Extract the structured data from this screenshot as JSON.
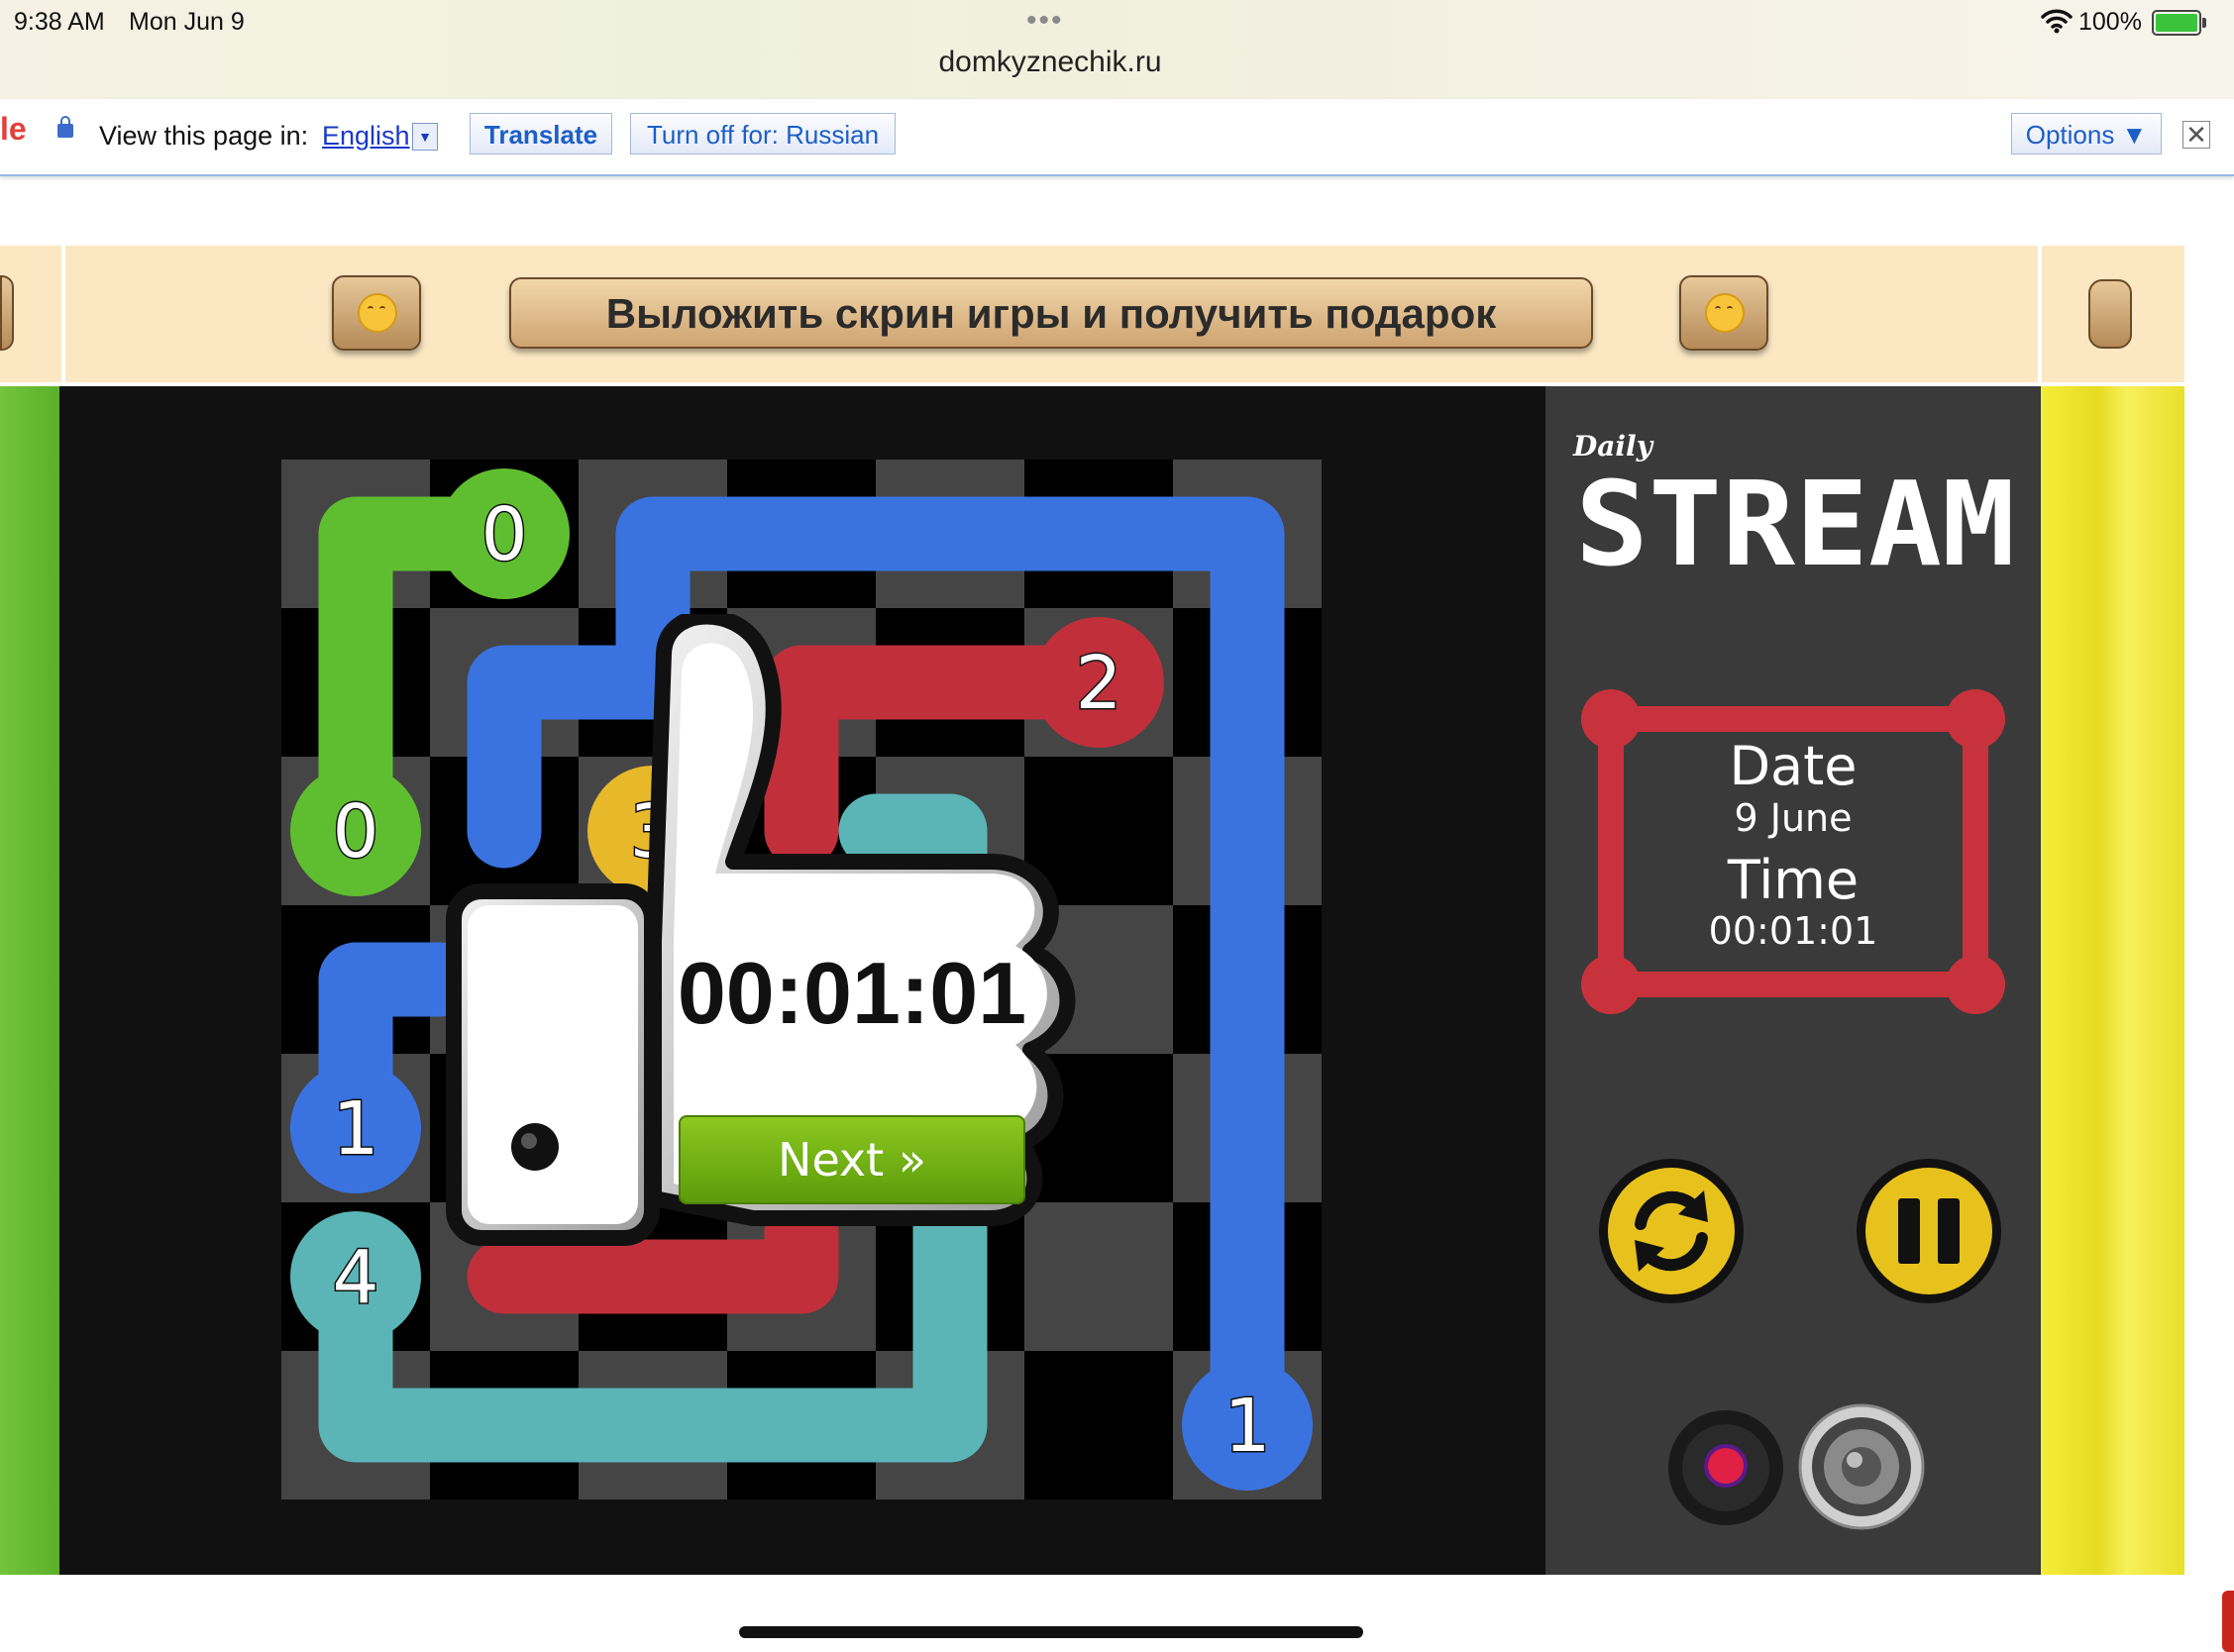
{
  "status_bar": {
    "time": "9:38 AM",
    "date": "Mon Jun 9",
    "url": "domkyznechik.ru",
    "battery": "100%"
  },
  "translate_bar": {
    "logo_fragment": "le",
    "label": "View this page in:",
    "language": "English",
    "translate_button": "Translate",
    "turn_off_button": "Turn off for: Russian",
    "options_button": "Options ▼",
    "close": "✕"
  },
  "banner": {
    "share_button": "Выложить скрин игры и получить подарок"
  },
  "board": {
    "size": 7,
    "endpoints": [
      {
        "label": "0",
        "color": "#5fbe2f",
        "row": 0,
        "col": 1
      },
      {
        "label": "0",
        "color": "#5fbe2f",
        "row": 2,
        "col": 0
      },
      {
        "label": "2",
        "color": "#c12f3b",
        "row": 1,
        "col": 5
      },
      {
        "label": "3",
        "color": "#e7b92a",
        "row": 2,
        "col": 2
      },
      {
        "label": "1",
        "color": "#3a73e0",
        "row": 4,
        "col": 0
      },
      {
        "label": "4",
        "color": "#5bb5b6",
        "row": 5,
        "col": 0
      },
      {
        "label": "1",
        "color": "#3a73e0",
        "row": 6,
        "col": 6
      }
    ]
  },
  "sidebar": {
    "daily": "Daily",
    "title": "STREAM",
    "date_label": "Date",
    "date_value": "9 June",
    "time_label": "Time",
    "time_value": "00:01:01",
    "accent_color": "#c8323d",
    "button_color": "#e8c21c"
  },
  "overlay": {
    "final_time": "00:01:01",
    "next_button": "Next »"
  }
}
